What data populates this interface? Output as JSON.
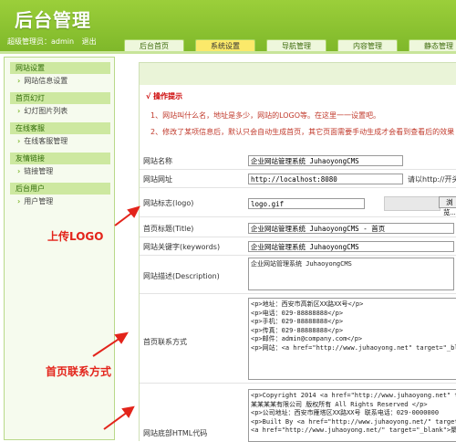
{
  "header": {
    "title": "后台管理",
    "user_label": "超级管理员：admin",
    "logout": "退出",
    "tabs": [
      "后台首页",
      "系统设置",
      "导航管理",
      "内容管理",
      "静态管理"
    ]
  },
  "sidebar": {
    "groups": [
      {
        "title": "网站设置",
        "items": [
          "网站信息设置"
        ]
      },
      {
        "title": "首页幻灯",
        "items": [
          "幻灯图片列表"
        ]
      },
      {
        "title": "在线客服",
        "items": [
          "在线客服管理"
        ]
      },
      {
        "title": "友情链接",
        "items": [
          "链接管理"
        ]
      },
      {
        "title": "后台用户",
        "items": [
          "用户管理"
        ]
      }
    ]
  },
  "tips": {
    "title": "√ 操作提示",
    "line1": "1、网站叫什么名，地址是多少，网站的LOGO等。在这里一一设置吧。",
    "line2": "2、修改了某项信息后，默认只会自动生成首页，其它页面需要手动生成才会看到查看后的效果"
  },
  "form": {
    "site_name": {
      "label": "网站名称",
      "value": "企业网站管理系统 JuhaoyongCMS"
    },
    "site_url": {
      "label": "网站网址",
      "value": "http://localhost:8080",
      "hint": "请以http://开头"
    },
    "logo": {
      "label": "网站标志(logo)",
      "value": "logo.gif",
      "browse": "浏览..."
    },
    "page_title": {
      "label": "首页标题(Title)",
      "value": "企业网站管理系统 JuhaoyongCMS - 首页"
    },
    "keywords": {
      "label": "网站关键字(keywords)",
      "value": "企业网站管理系统 JuhaoyongCMS"
    },
    "description": {
      "label": "网站描述(Description)",
      "value": "企业网站管理系统 JuhaoyongCMS"
    },
    "contact": {
      "label": "首页联系方式",
      "value": "<p>地址：西安市高新区XX路XX号</p>\n<p>电话：029-88888888</p>\n<p>手机：029-88888888</p>\n<p>传真：029-88888888</p>\n<p>邮件：admin@company.com</p>\n<p>网站：<a href=\"http://www.juhaoyong.net\" target=\"_blank"
    },
    "footer": {
      "label": "网站底部HTML代码",
      "value": "<p>Copyright 2014 <a href=\"http://www.juhaoyong.net\" targ\n某某某某有限公司 版权所有 All Rights Reserved </p>\n<p>公司地址：西安市雁塔区XX路XX号 联系电话：029-0000000\n<p>Built By <a href=\"http://www.juhaoyong.net/\" target=\"_\n<a href=\"http://www.juhaoyong.net/\" target=\"_blank\">聚好"
    }
  },
  "annotations": {
    "upload_logo": "上传LOGO",
    "contact": "首页联系方式"
  }
}
